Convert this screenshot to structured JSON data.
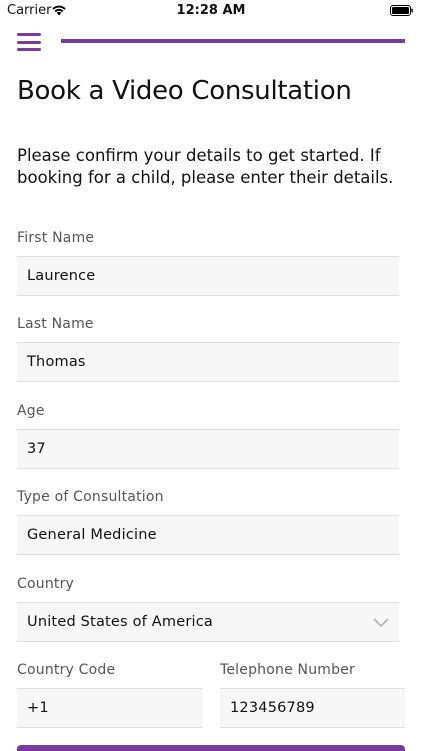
{
  "status_bar": {
    "carrier": "Carrier",
    "time": "12:28 AM"
  },
  "header": {
    "menu_icon": "hamburger-icon",
    "progress_fraction": 1.0,
    "accent_color": "#7b3aa0"
  },
  "page": {
    "title": "Book a Video Consultation",
    "intro": "Please confirm your details to get started. If booking for a child, please enter their details."
  },
  "form": {
    "first_name": {
      "label": "First Name",
      "value": "Laurence"
    },
    "last_name": {
      "label": "Last Name",
      "value": "Thomas"
    },
    "age": {
      "label": "Age",
      "value": "37"
    },
    "consultation_type": {
      "label": "Type of Consultation",
      "value": "General Medicine"
    },
    "country": {
      "label": "Country",
      "value": "United States of America",
      "icon": "chevron-down-icon"
    },
    "country_code": {
      "label": "Country Code",
      "value": "+1"
    },
    "telephone": {
      "label": "Telephone Number",
      "value": "123456789"
    }
  }
}
